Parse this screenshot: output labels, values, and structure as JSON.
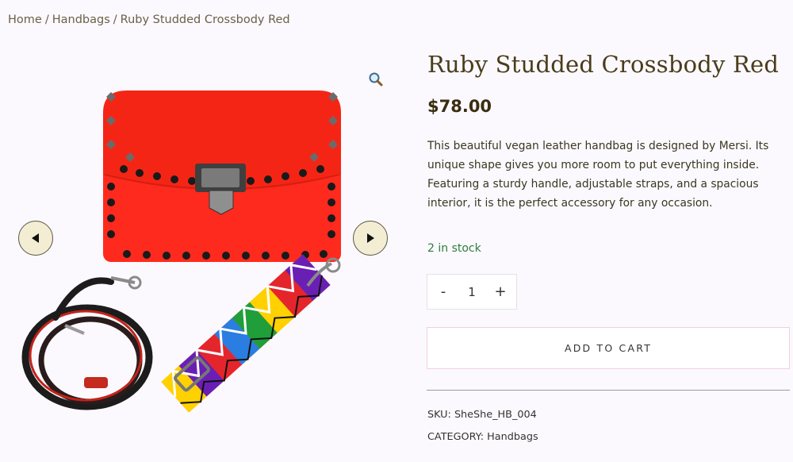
{
  "breadcrumb": {
    "home": "Home",
    "category": "Handbags",
    "current": "Ruby Studded Crossbody Red",
    "separator": "/"
  },
  "product": {
    "title": "Ruby Studded Crossbody Red",
    "price": "$78.00",
    "description": "This beautiful vegan leather handbag is designed by Mersi. Its unique shape gives you more room to put everything inside. Featuring a sturdy handle, adjustable straps, and a spacious interior, it is the perfect accessory for any occasion.",
    "stock": "2 in stock",
    "quantity": "1",
    "qty_minus": "-",
    "qty_plus": "+",
    "add_to_cart": "ADD TO CART",
    "sku_label": "SKU:",
    "sku_value": "SheShe_HB_004",
    "category_label": "CATEGORY:",
    "category_value": "Handbags"
  },
  "gallery": {
    "zoom_icon": "magnifier-icon",
    "prev_icon": "triangle-left-icon",
    "next_icon": "triangle-right-icon"
  },
  "colors": {
    "bag_red": "#ff2a1e",
    "stock_green": "#2e7d3d",
    "nav_button_bg": "#f3edd3",
    "title_color": "#4a3c1c"
  }
}
